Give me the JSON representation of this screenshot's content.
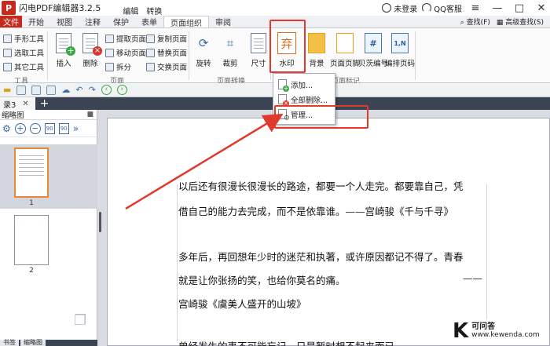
{
  "app": {
    "logo_text": "P",
    "title": "闪电PDF编辑器3.2.5",
    "menu": [
      "编辑",
      "转换"
    ],
    "user_status": "未登录",
    "support": "QQ客服",
    "window_controls": [
      "≡",
      "—",
      "□",
      "✕"
    ]
  },
  "ribbon_tabs": {
    "file": "文件",
    "tabs": [
      "开始",
      "视图",
      "注释",
      "保护",
      "表单",
      "页面组织",
      "审阅"
    ],
    "active": "页面组织",
    "right_links": [
      "查找(F)",
      "高级查找(S)"
    ]
  },
  "ribbon": {
    "tools_group": {
      "items": [
        "手形工具",
        "选取工具",
        "其它工具"
      ],
      "label": "工具"
    },
    "page_group": {
      "insert": "插入",
      "delete": "删除",
      "extract": "提取页面",
      "move": "移动页面",
      "split": "拆分",
      "copy": "复制页面",
      "replace": "替换页面",
      "swap": "交换页面",
      "label": "页面"
    },
    "page_transform_group": {
      "rotate": "旋转",
      "crop": "裁剪",
      "size": "尺寸",
      "label": "页面转换"
    },
    "page_mark_group": {
      "watermark": "水印",
      "watermark_glyph": "弃",
      "background": "背景",
      "header_footer": "页面页脚",
      "bates": "贝茨编号",
      "bates_glyph": "#",
      "page_number": "编排页码",
      "page_number_glyph": "1,N",
      "label": "页面标记"
    }
  },
  "watermark_menu": {
    "items": [
      "添加...",
      "全部删除...",
      "管理..."
    ]
  },
  "document_tabs": {
    "active_tab": "录3",
    "close": "✕",
    "add": "+"
  },
  "thumbnail_panel": {
    "title": "缩略图",
    "pages": [
      "1",
      "2"
    ],
    "bottom_tabs": [
      "书签",
      "缩略图"
    ]
  },
  "document": {
    "paragraphs": [
      "以后还有很漫长很漫长的路途，都要一个人走完。都要靠自己，凭",
      "借自己的能力去完成，而不是依靠谁。——宫崎骏《千与千寻》",
      "多年后，再回想年少时的迷茫和执著，或许原因都记不得了。青春",
      "就是让你张扬的笑，也给你莫名的痛。",
      "宫崎骏《虞美人盛开的山坡》",
      "曾经发生的事不可能忘记，只是暂时想不起来而已。——"
    ],
    "dash": "——"
  },
  "site_watermark": {
    "letter": "K",
    "name": "可问答",
    "url": "www.kewenda.com"
  },
  "colors": {
    "brand_red": "#c8291d",
    "annotation_red": "#e03a2e",
    "accent_orange": "#e06b1e"
  }
}
